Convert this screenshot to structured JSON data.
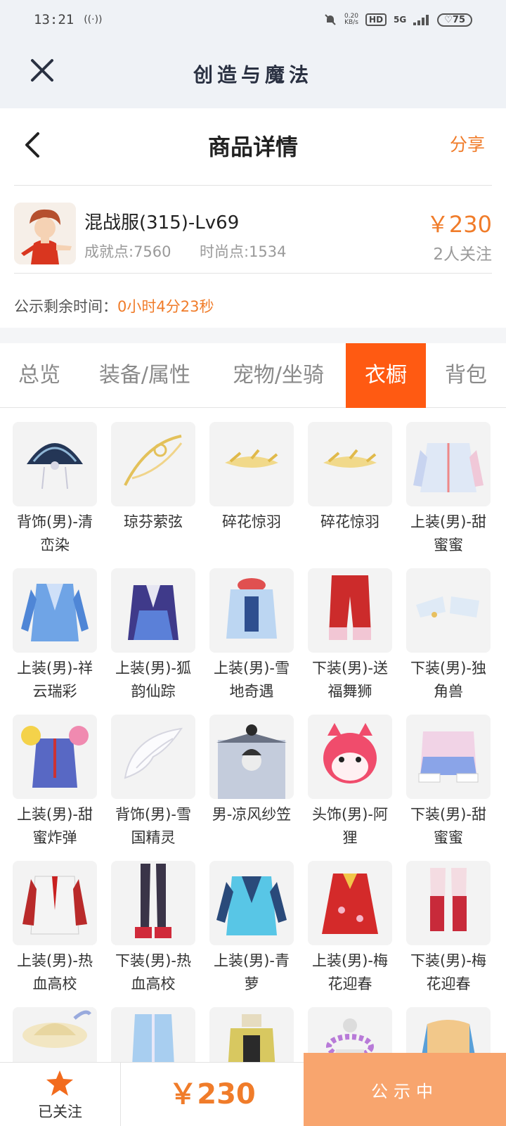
{
  "status_bar": {
    "time": "13:21",
    "net_speed": "0.20\nKB/s",
    "hd": "HD",
    "signal": "5G",
    "battery": "75"
  },
  "app": {
    "title": "创造与魔法"
  },
  "page": {
    "title": "商品详情",
    "share": "分享"
  },
  "item": {
    "name": "混战服(315)-Lv69",
    "achievement": "成就点:7560",
    "fashion": "时尚点:1534",
    "price": "￥230",
    "watchers": "2人关注"
  },
  "notice": {
    "label": "公示剩余时间：",
    "time_left": "0小时4分23秒"
  },
  "tabs": [
    "总览",
    "装备/属性",
    "宠物/坐骑",
    "衣橱",
    "背包"
  ],
  "active_tab": "衣橱",
  "wardrobe": [
    "背饰(男)-清峦染",
    "琼芬萦弦",
    "碎花惊羽",
    "碎花惊羽",
    "上装(男)-甜蜜蜜",
    "上装(男)-祥云瑞彩",
    "上装(男)-狐韵仙踪",
    "上装(男)-雪地奇遇",
    "下装(男)-送福舞狮",
    "下装(男)-独角兽",
    "上装(男)-甜蜜炸弹",
    "背饰(男)-雪国精灵",
    "男-凉风纱笠",
    "头饰(男)-阿狸",
    "下装(男)-甜蜜蜜",
    "上装(男)-热血高校",
    "下装(男)-热血高校",
    "上装(男)-青萝",
    "上装(男)-梅花迎春",
    "下装(男)-梅花迎春",
    "",
    "",
    "",
    "",
    ""
  ],
  "bottom": {
    "follow_label": "已关注",
    "price": "￥230",
    "status": "公示中"
  },
  "colors": {
    "accent": "#f07c2a",
    "tab_active": "#ff5a12",
    "status_button": "#f8a56e"
  }
}
